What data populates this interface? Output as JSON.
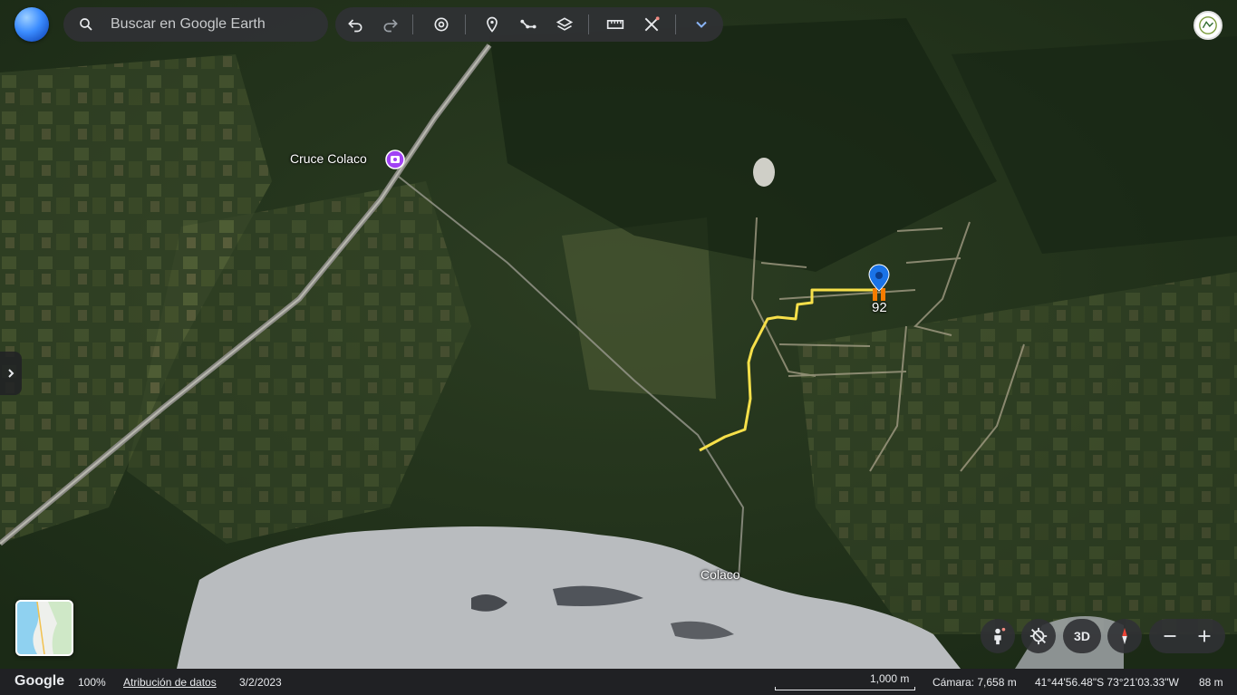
{
  "search": {
    "placeholder": "Buscar en Google Earth"
  },
  "map": {
    "place_labels": [
      "Cruce Colaco",
      "Colaco"
    ],
    "placemark_label": "92"
  },
  "controls": {
    "view_3d": "3D"
  },
  "status": {
    "brand": "Google",
    "zoom": "100%",
    "attribution": "Atribución de datos",
    "date": "3/2/2023",
    "scale": "1,000 m",
    "camera": "Cámara: 7,658 m",
    "coords": "41°44'56.48\"S 73°21'03.33\"W",
    "elevation": "88 m"
  },
  "colors": {
    "route": "#f7e04a",
    "placemark": "#1a73e8",
    "marker_base": "#f57c00",
    "poi": "#a142f4"
  }
}
